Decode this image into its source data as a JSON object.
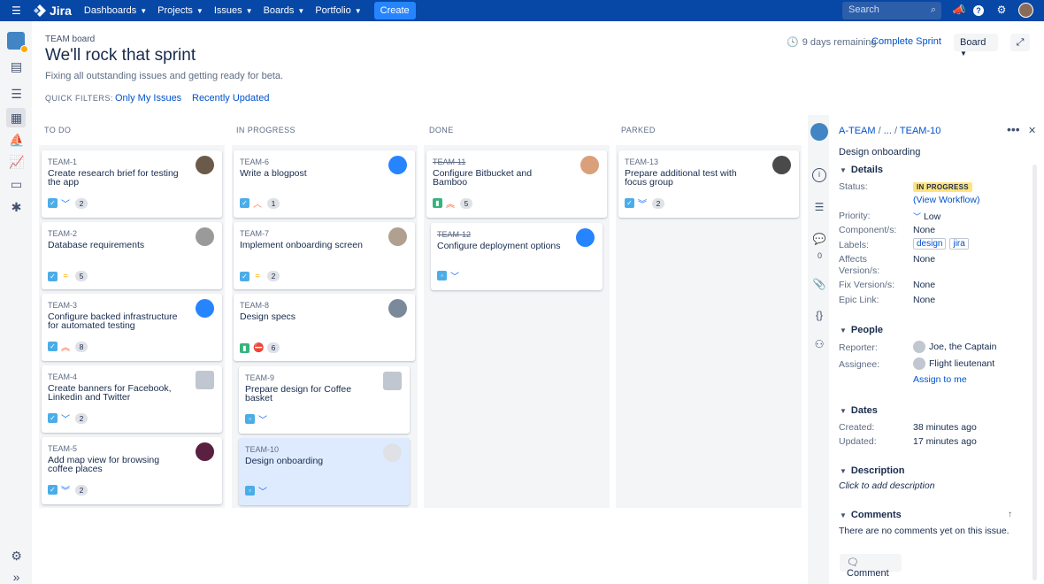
{
  "nav": {
    "logo_text": "Jira",
    "items": [
      "Dashboards",
      "Projects",
      "Issues",
      "Boards",
      "Portfolio"
    ],
    "create_label": "Create",
    "search_placeholder": "Search"
  },
  "header": {
    "board_name": "TEAM board",
    "sprint_name": "We'll rock that sprint",
    "sprint_goal": "Fixing all outstanding issues and getting ready for beta.",
    "quick_filters_label": "QUICK FILTERS:",
    "filters": [
      "Only My Issues",
      "Recently Updated"
    ],
    "days_remaining": "9 days remaining",
    "complete_sprint": "Complete Sprint",
    "board_menu": "Board"
  },
  "columns": [
    {
      "name": "TO DO"
    },
    {
      "name": "IN PROGRESS"
    },
    {
      "name": "DONE"
    },
    {
      "name": "PARKED"
    }
  ],
  "cards": {
    "team1": {
      "key": "TEAM-1",
      "title": "Create research brief for testing the app",
      "estimate": "2",
      "priority": "low"
    },
    "team2": {
      "key": "TEAM-2",
      "title": "Database requirements",
      "estimate": "5",
      "priority": "medium"
    },
    "team3": {
      "key": "TEAM-3",
      "title": "Configure backed infrastructure for automated testing",
      "estimate": "8",
      "priority": "highest"
    },
    "team4": {
      "key": "TEAM-4",
      "title": "Create banners for Facebook, Linkedin and Twitter",
      "estimate": "2",
      "priority": "low"
    },
    "team5": {
      "key": "TEAM-5",
      "title": "Add map view for browsing coffee places",
      "estimate": "2",
      "priority": "lowest"
    },
    "team6": {
      "key": "TEAM-6",
      "title": "Write a blogpost",
      "estimate": "1",
      "priority": "high"
    },
    "team7": {
      "key": "TEAM-7",
      "title": "Implement onboarding screen",
      "estimate": "2",
      "priority": "medium"
    },
    "team8": {
      "key": "TEAM-8",
      "title": "Design specs",
      "estimate": "6",
      "priority": "blocker"
    },
    "team9": {
      "key": "TEAM-9",
      "title": "Prepare design for Coffee basket",
      "priority": "low"
    },
    "team10": {
      "key": "TEAM-10",
      "title": "Design onboarding",
      "priority": "low"
    },
    "team11": {
      "key": "TEAM-11",
      "title": "Configure Bitbucket and Bamboo",
      "estimate": "5",
      "priority": "highest"
    },
    "team12": {
      "key": "TEAM-12",
      "title": "Configure deployment options",
      "priority": "low"
    },
    "team13": {
      "key": "TEAM-13",
      "title": "Prepare additional test with focus group",
      "estimate": "2",
      "priority": "lowest"
    }
  },
  "panel": {
    "breadcrumb_project": "A-TEAM",
    "breadcrumb_mid": "...",
    "breadcrumb_issue": "TEAM-10",
    "summary": "Design onboarding",
    "comments_count": "0",
    "details_heading": "Details",
    "status_label": "Status:",
    "status_value": "IN PROGRESS",
    "view_workflow": "(View Workflow)",
    "priority_label": "Priority:",
    "priority_value": "Low",
    "components_label": "Component/s:",
    "components_value": "None",
    "labels_label": "Labels:",
    "labels": [
      "design",
      "jira"
    ],
    "affects_label": "Affects Version/s:",
    "affects_value": "None",
    "fix_label": "Fix Version/s:",
    "fix_value": "None",
    "epic_label": "Epic Link:",
    "epic_value": "None",
    "people_heading": "People",
    "reporter_label": "Reporter:",
    "reporter_value": "Joe, the Captain",
    "assignee_label": "Assignee:",
    "assignee_value": "Flight lieutenant",
    "assign_to_me": "Assign to me",
    "dates_heading": "Dates",
    "created_label": "Created:",
    "created_value": "38 minutes ago",
    "updated_label": "Updated:",
    "updated_value": "17 minutes ago",
    "description_heading": "Description",
    "description_placeholder": "Click to add description",
    "comments_heading": "Comments",
    "no_comments": "There are no comments yet on this issue.",
    "comment_button": "Comment"
  },
  "colors": {
    "nav_bg": "#0747a6",
    "create_bg": "#2684ff",
    "link": "#0052cc",
    "status_inprogress_bg": "#ffe380",
    "selected_card_bg": "#deebff"
  }
}
